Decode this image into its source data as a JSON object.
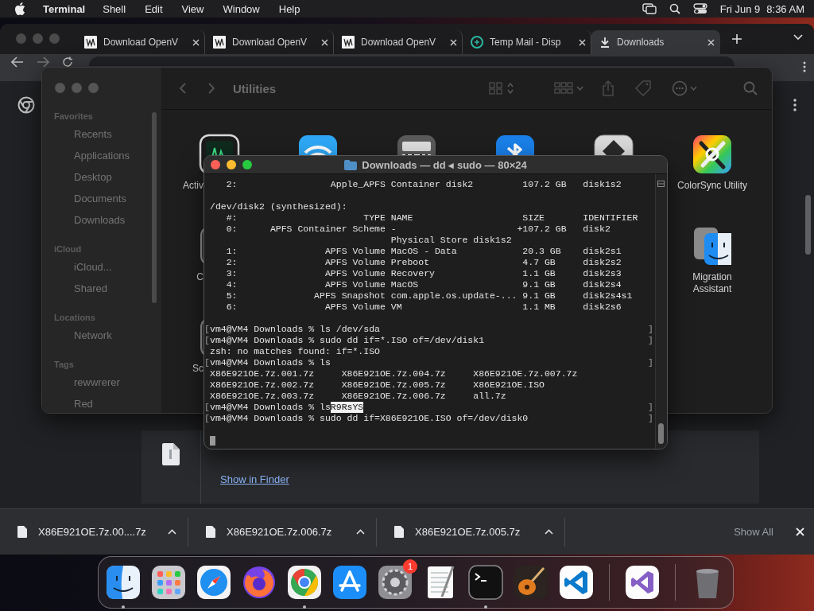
{
  "menu_bar": {
    "app": "Terminal",
    "menus": [
      "Shell",
      "Edit",
      "View",
      "Window",
      "Help"
    ],
    "date": "Fri Jun 9",
    "time": "8:36 AM"
  },
  "browser": {
    "tabs": [
      {
        "title": "Download OpenV",
        "kind": "vw",
        "selected": false
      },
      {
        "title": "Download OpenV",
        "kind": "vw",
        "selected": false
      },
      {
        "title": "Download OpenV",
        "kind": "vw",
        "selected": false
      },
      {
        "title": "Temp Mail - Disp",
        "kind": "mail",
        "selected": false
      },
      {
        "title": "Downloads",
        "kind": "download",
        "selected": true
      }
    ],
    "download_card": {
      "link": "Show in Finder"
    },
    "download_shelf": {
      "items": [
        {
          "name": "X86E921OE.7z.00....7z"
        },
        {
          "name": "X86E921OE.7z.006.7z"
        },
        {
          "name": "X86E921OE.7z.005.7z"
        }
      ],
      "show_all": "Show All"
    }
  },
  "finder": {
    "title": "Utilities",
    "sidebar": [
      {
        "heading": "Favorites",
        "items": [
          "Recents",
          "Applications",
          "Desktop",
          "Documents",
          "Downloads"
        ]
      },
      {
        "heading": "iCloud",
        "items": [
          "iCloud...",
          "Shared"
        ]
      },
      {
        "heading": "Locations",
        "items": [
          "Network"
        ]
      },
      {
        "heading": "Tags",
        "items": [
          "rewwrerer",
          "Red"
        ]
      }
    ],
    "apps": [
      [
        {
          "kind": "activity",
          "label": "Activ"
        },
        {
          "kind": "wifi"
        },
        {
          "kind": "keyboard"
        },
        {
          "kind": "bluetooth"
        },
        {
          "kind": "diamond"
        },
        {
          "kind": "colorsync",
          "label": "ColorSync Utility"
        }
      ],
      [
        {
          "kind": "generic",
          "label": "C"
        },
        {
          "kind": "covered"
        },
        {
          "kind": "covered"
        },
        {
          "kind": "covered"
        },
        {
          "kind": "covered"
        },
        {
          "kind": "migration",
          "label": "Migration Assistant"
        }
      ],
      [
        {
          "kind": "generic",
          "label": "Sc"
        }
      ]
    ]
  },
  "terminal": {
    "title": "Downloads — dd ◂ sudo — 80×24",
    "lines": [
      {
        "kind": "output",
        "text": "   2:                 Apple_APFS Container disk2         107.2 GB   disk1s2"
      },
      {
        "kind": "blank"
      },
      {
        "kind": "output",
        "text": "/dev/disk2 (synthesized):"
      },
      {
        "kind": "output",
        "text": "   #:                       TYPE NAME                    SIZE       IDENTIFIER"
      },
      {
        "kind": "output",
        "text": "   0:      APFS Container Scheme -                      +107.2 GB   disk2"
      },
      {
        "kind": "output",
        "text": "                                 Physical Store disk1s2"
      },
      {
        "kind": "output",
        "text": "   1:                APFS Volume MacOS - Data            20.3 GB    disk2s1"
      },
      {
        "kind": "output",
        "text": "   2:                APFS Volume Preboot                 4.7 GB     disk2s2"
      },
      {
        "kind": "output",
        "text": "   3:                APFS Volume Recovery                1.1 GB     disk2s3"
      },
      {
        "kind": "output",
        "text": "   4:                APFS Volume MacOS                   9.1 GB     disk2s4"
      },
      {
        "kind": "output",
        "text": "   5:              APFS Snapshot com.apple.os.update-... 9.1 GB     disk2s4s1"
      },
      {
        "kind": "output",
        "text": "   6:                APFS Volume VM                      1.1 MB     disk2s6"
      },
      {
        "kind": "blank"
      },
      {
        "kind": "prompt",
        "open": "[",
        "text": "vm4@VM4 Downloads % ls /dev/sda",
        "close": "]"
      },
      {
        "kind": "prompt",
        "open": "[",
        "text": "vm4@VM4 Downloads % sudo dd if=*.ISO of=/dev/disk1",
        "close": "]"
      },
      {
        "kind": "output",
        "text": "zsh: no matches found: if=*.ISO"
      },
      {
        "kind": "prompt",
        "open": "[",
        "text": "vm4@VM4 Downloads % ls",
        "close": "]"
      },
      {
        "kind": "output",
        "text": "X86E921OE.7z.001.7z     X86E921OE.7z.004.7z     X86E921OE.7z.007.7z"
      },
      {
        "kind": "output",
        "text": "X86E921OE.7z.002.7z     X86E921OE.7z.005.7z     X86E921OE.ISO"
      },
      {
        "kind": "output",
        "text": "X86E921OE.7z.003.7z     X86E921OE.7z.006.7z     all.7z"
      },
      {
        "kind": "prompt",
        "open": "[",
        "text": "vm4@VM4 Downloads % ls",
        "selection": "R9RsYS",
        "close": "]"
      },
      {
        "kind": "prompt",
        "open": "[",
        "text": "vm4@VM4 Downloads % sudo dd if=X86E921OE.ISO of=/dev/disk0",
        "close": "]"
      },
      {
        "kind": "blank"
      },
      {
        "kind": "cursor"
      }
    ]
  },
  "dock": {
    "items": [
      {
        "kind": "finder",
        "running": true
      },
      {
        "kind": "launchpad",
        "running": false
      },
      {
        "kind": "safari",
        "running": false
      },
      {
        "kind": "firefox",
        "running": false
      },
      {
        "kind": "chrome",
        "running": true
      },
      {
        "kind": "appstore",
        "running": false
      },
      {
        "kind": "settings",
        "running": false,
        "badge": "1"
      },
      {
        "kind": "textedit",
        "running": false
      },
      {
        "kind": "terminal",
        "running": true
      },
      {
        "kind": "guitar",
        "running": false
      },
      {
        "kind": "vscode",
        "running": false
      },
      {
        "kind": "separator"
      },
      {
        "kind": "visualstudio",
        "running": false
      },
      {
        "kind": "separator"
      },
      {
        "kind": "trash",
        "running": false
      }
    ]
  }
}
